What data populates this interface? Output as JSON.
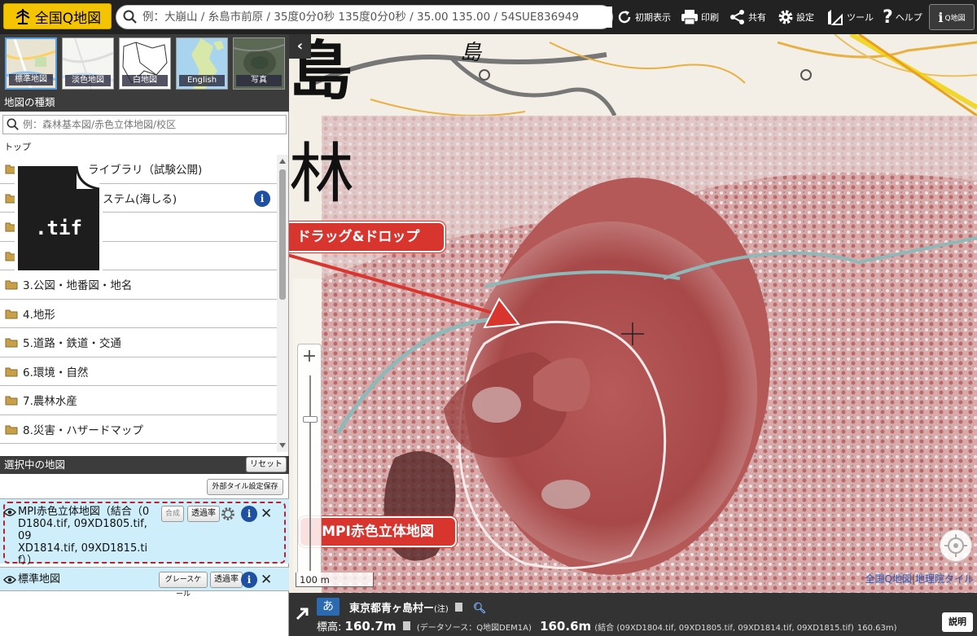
{
  "app": {
    "title": "全国Q地図"
  },
  "search": {
    "placeholder": "例：大崩山 / 糸島市前原 / 35度0分0秒 135度0分0秒 / 35.00 135.00 / 54SUE836949"
  },
  "toolbar": {
    "reset_view": "初期表示",
    "print": "印刷",
    "share": "共有",
    "settings": "設定",
    "tools": "ツール",
    "help": "ヘルプ",
    "qchizu": "Q地図"
  },
  "basemaps": [
    {
      "label": "標準地図",
      "selected": true
    },
    {
      "label": "淡色地図",
      "selected": false
    },
    {
      "label": "白地図",
      "selected": false
    },
    {
      "label": "English",
      "selected": false
    },
    {
      "label": "写真",
      "selected": false
    }
  ],
  "map_types": {
    "header": "地図の種類",
    "search_placeholder": "例：森林基本図/赤色立体地図/校区",
    "breadcrumb": "トップ",
    "items": [
      {
        "label": "ライブラリ（試験公開)",
        "info": false
      },
      {
        "label": "ステム(海しる)",
        "info": true
      },
      {
        "label": "",
        "info": false
      },
      {
        "label": "",
        "info": false
      },
      {
        "label": "3.公図・地番図・地名",
        "info": false
      },
      {
        "label": "4.地形",
        "info": false
      },
      {
        "label": "5.道路・鉄道・交通",
        "info": false
      },
      {
        "label": "6.環境・自然",
        "info": false
      },
      {
        "label": "7.農林水産",
        "info": false
      },
      {
        "label": "8.災害・ハザードマップ",
        "info": false
      }
    ]
  },
  "selected_maps": {
    "header": "選択中の地図",
    "reset_label": "リセット",
    "save_external_label": "外部タイル設定保存",
    "layers": [
      {
        "name_lines": [
          "MPI赤色立体地図（結合（0",
          "D1804.tif, 09XD1805.tif, 09",
          "XD1814.tif, 09XD1815.ti",
          "f））"
        ],
        "composite_label": "合成",
        "opacity_label": "透過率"
      },
      {
        "name_lines": [
          "標準地図"
        ],
        "grayscale_label": "グレースケール",
        "opacity_label": "透過率"
      }
    ]
  },
  "file_icon": {
    "ext": ".tif"
  },
  "callouts": {
    "drag_drop": "ドラッグ&ドロップ",
    "layer_name": "MPI赤色立体地図"
  },
  "map": {
    "scale": "100 m",
    "attribution_link1": "全国Q地図",
    "attribution_sep": "|",
    "attribution_link2": "地理院タイル",
    "label_shima": "島",
    "label_rin": "林"
  },
  "status": {
    "kana_btn": "あ",
    "address": "東京都青ヶ島村ー",
    "address_note": "(注)",
    "elev_label": "標高:",
    "elev_value": "160.7m",
    "source_note": "(データソース：Q地図DEM1A)",
    "elev_value2": "160.6m",
    "combined_note": "(結合 (09XD1804.tif, 09XD1805.tif, 09XD1814.tif, 09XD1815.tif)",
    "combined_value": "160.63m)",
    "explain_btn": "説明"
  },
  "colors": {
    "accent": "#f4c400",
    "callout": "#d9352f",
    "relief": "#b84a4a"
  }
}
